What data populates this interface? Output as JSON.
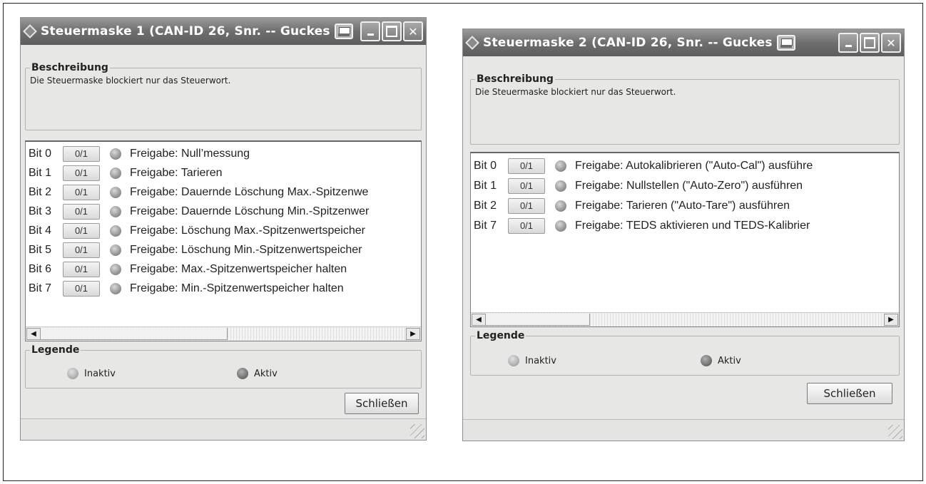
{
  "windows": [
    {
      "title": "Steuermaske 1 (CAN-ID 26, Snr. -- Guckes",
      "description_label": "Beschreibung",
      "description_text": "Die Steuermaske blockiert nur das Steuerwort.",
      "rows": [
        {
          "bit": "Bit 0",
          "button": "0/1",
          "label": "Freigabe: Null’messung"
        },
        {
          "bit": "Bit 1",
          "button": "0/1",
          "label": "Freigabe: Tarieren"
        },
        {
          "bit": "Bit 2",
          "button": "0/1",
          "label": "Freigabe: Dauernde Löschung Max.-Spitzenwe"
        },
        {
          "bit": "Bit 3",
          "button": "0/1",
          "label": "Freigabe: Dauernde Löschung Min.-Spitzenwer"
        },
        {
          "bit": "Bit 4",
          "button": "0/1",
          "label": "Freigabe: Löschung Max.-Spitzenwertspeicher"
        },
        {
          "bit": "Bit 5",
          "button": "0/1",
          "label": "Freigabe: Löschung Min.-Spitzenwertspeicher"
        },
        {
          "bit": "Bit 6",
          "button": "0/1",
          "label": "Freigabe: Max.-Spitzenwertspeicher halten"
        },
        {
          "bit": "Bit 7",
          "button": "0/1",
          "label": "Freigabe: Min.-Spitzenwertspeicher halten"
        }
      ],
      "legend_label": "Legende",
      "legend_inactive": "Inaktiv",
      "legend_active": "Aktiv",
      "close_label": "Schließen"
    },
    {
      "title": "Steuermaske 2 (CAN-ID 26, Snr. -- Guckes",
      "description_label": "Beschreibung",
      "description_text": "Die Steuermaske blockiert nur das Steuerwort.",
      "rows": [
        {
          "bit": "Bit 0",
          "button": "0/1",
          "label": "Freigabe: Autokalibrieren (\"Auto-Cal\") ausführe"
        },
        {
          "bit": "Bit 1",
          "button": "0/1",
          "label": "Freigabe: Nullstellen (\"Auto-Zero\") ausführen"
        },
        {
          "bit": "Bit 2",
          "button": "0/1",
          "label": "Freigabe: Tarieren (\"Auto-Tare\") ausführen"
        },
        {
          "bit": "Bit 7",
          "button": "0/1",
          "label": "Freigabe: TEDS aktivieren und TEDS-Kalibrier"
        }
      ],
      "legend_label": "Legende",
      "legend_inactive": "Inaktiv",
      "legend_active": "Aktiv",
      "close_label": "Schließen"
    }
  ]
}
